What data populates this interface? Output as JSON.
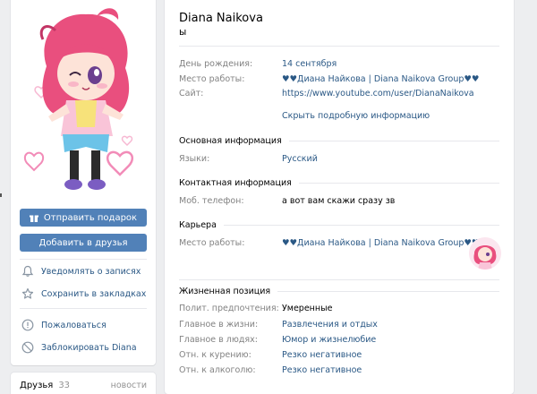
{
  "profile": {
    "name": "Diana Naikova",
    "status": "ы"
  },
  "left": {
    "gift_button": "Отправить подарок",
    "add_friend_button": "Добавить в друзья",
    "actions": [
      "Уведомлять о записях",
      "Сохранить в закладках",
      "Пожаловаться",
      "Заблокировать Diana"
    ],
    "friends_label": "Друзья",
    "friends_count": "33",
    "friends_all": "новости"
  },
  "info": {
    "birthday_label": "День рождения:",
    "birthday_value": "14 сентября",
    "work_label": "Место работы:",
    "work_value": "♥♥Диана Найкова | Diana Naikova Group♥♥",
    "site_label": "Сайт:",
    "site_value": "https://www.youtube.com/user/DianaNaikova",
    "hide_link": "Скрыть подробную информацию"
  },
  "sections": {
    "basic": "Основная информация",
    "languages_label": "Языки:",
    "languages_value": "Русский",
    "contacts": "Контактная информация",
    "phone_label": "Моб. телефон:",
    "phone_value": "а вот вам скажи сразу зв",
    "career": "Карьера",
    "career_work_label": "Место работы:",
    "career_work_value": "♥♥Диана Найкова | Diana Naikova Group♥♥",
    "life": "Жизненная позиция",
    "politics_label": "Полит. предпочтения:",
    "politics_value": "Умеренные",
    "main_life_label": "Главное в жизни:",
    "main_life_value": "Развлечения и отдых",
    "main_people_label": "Главное в людях:",
    "main_people_value": "Юмор и жизнелюбие",
    "smoking_label": "Отн. к курению:",
    "smoking_value": "Резко негативное",
    "alcohol_label": "Отн. к алкоголю:",
    "alcohol_value": "Резко негативное"
  },
  "colors": {
    "accent": "#5181b8",
    "link": "#2a5885",
    "label": "#828282",
    "background": "#edeef0"
  },
  "icons": {
    "gift": "gift-icon",
    "bell": "bell-icon",
    "star": "star-icon",
    "report": "exclamation-icon",
    "block": "block-icon"
  }
}
